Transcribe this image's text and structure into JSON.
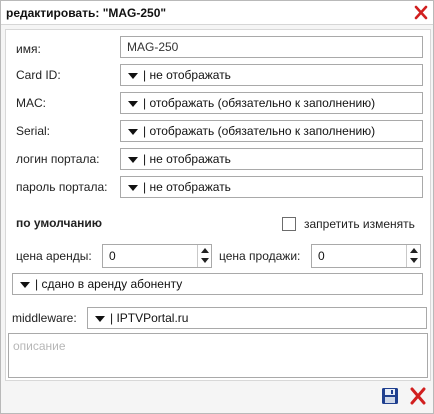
{
  "dialog": {
    "title": "редактировать: \"MAG-250\"",
    "close_icon": "close-icon"
  },
  "form": {
    "name_label": "имя:",
    "name_value": "MAG-250",
    "card_id_label": "Card ID:",
    "card_id_value": "| не отображать",
    "mac_label": "MAC:",
    "mac_value": "| отображать (обязательно к заполнению)",
    "serial_label": "Serial:",
    "serial_value": "| отображать (обязательно к заполнению)",
    "portal_login_label": "логин портала:",
    "portal_login_value": "| не отображать",
    "portal_password_label": "пароль портала:",
    "portal_password_value": "| не отображать",
    "defaults_heading": "по умолчанию",
    "forbid_change_label": "запретить изменять",
    "forbid_change_checked": false,
    "rent_price_label": "цена аренды:",
    "rent_price_value": "0",
    "sale_price_label": "цена продажи:",
    "sale_price_value": "0",
    "status_value": "| сдано в аренду абоненту",
    "middleware_label": "middleware:",
    "middleware_value": "| IPTVPortal.ru",
    "description_placeholder": "описание"
  },
  "footer": {
    "save_icon": "floppy-disk-icon",
    "cancel_icon": "red-x-icon"
  },
  "colors": {
    "close_red": "#d11f1f",
    "save_blue": "#1f3f8f"
  }
}
